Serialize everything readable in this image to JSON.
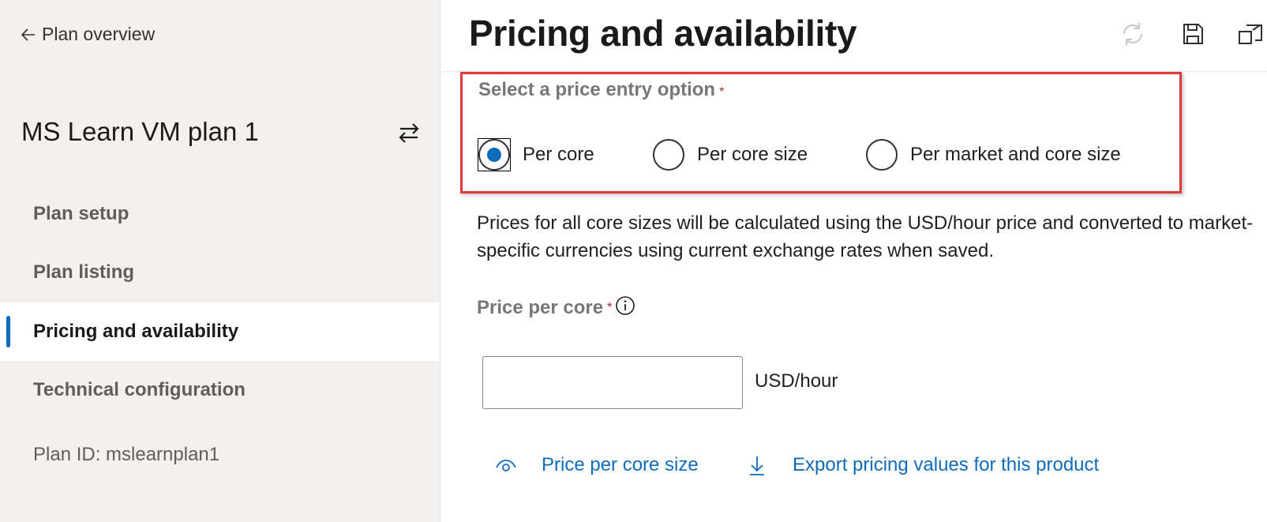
{
  "sidebar": {
    "back_label": "Plan overview",
    "plan_title": "MS Learn VM plan 1",
    "nav": [
      {
        "label": "Plan setup"
      },
      {
        "label": "Plan listing"
      },
      {
        "label": "Pricing and availability",
        "active": true
      },
      {
        "label": "Technical configuration"
      }
    ],
    "plan_id": "Plan ID: mslearnplan1"
  },
  "header": {
    "title": "Pricing and availability",
    "icons": [
      "refresh-icon",
      "save-icon",
      "pop-out-icon"
    ]
  },
  "price_entry": {
    "label": "Select a price entry option",
    "required_mark": "*",
    "options": [
      {
        "label": "Per core",
        "selected": true
      },
      {
        "label": "Per core size",
        "selected": false
      },
      {
        "label": "Per market and core size",
        "selected": false
      }
    ]
  },
  "description": "Prices for all core sizes will be calculated using the USD/hour price and converted to market-specific currencies using current exchange rates when saved.",
  "price_per_core": {
    "label": "Price per core",
    "required_mark": "*",
    "value": "",
    "unit": "USD/hour"
  },
  "actions": {
    "view_label": "Price per core size",
    "export_label": "Export pricing values for this product"
  },
  "colors": {
    "accent": "#0f6cbd",
    "highlight_border": "#e13a3a",
    "sidebar_bg": "#f2f1f0"
  }
}
